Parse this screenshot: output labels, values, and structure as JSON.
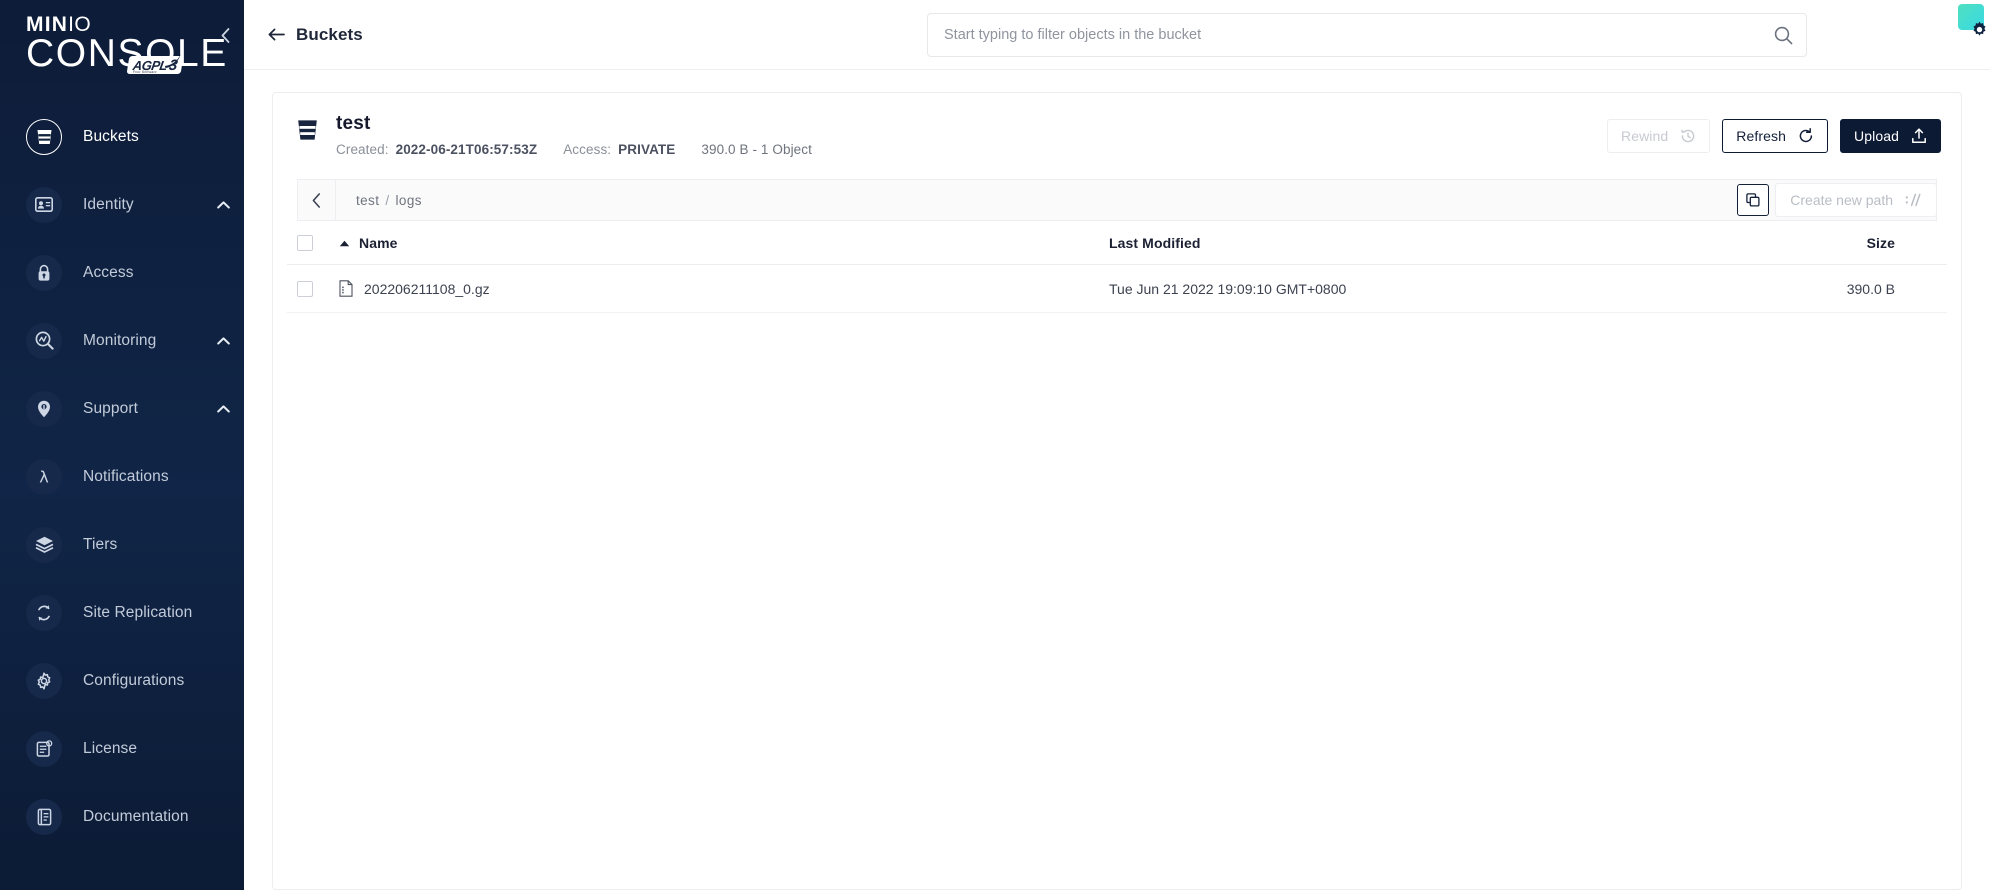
{
  "sidebar": {
    "logo": {
      "brand_primary": "MIN",
      "brand_secondary": "IO",
      "product": "CONSOLE",
      "license_badge": "AGPL",
      "license_version": "3",
      "license_sub": "Free Software"
    },
    "collapse_label": "collapse-sidebar",
    "items": [
      {
        "label": "Buckets",
        "icon": "bucket-icon",
        "active": true,
        "expandable": false
      },
      {
        "label": "Identity",
        "icon": "identity-card-icon",
        "active": false,
        "expandable": true
      },
      {
        "label": "Access",
        "icon": "lock-icon",
        "active": false,
        "expandable": false
      },
      {
        "label": "Monitoring",
        "icon": "monitoring-icon",
        "active": false,
        "expandable": true
      },
      {
        "label": "Support",
        "icon": "support-icon",
        "active": false,
        "expandable": true
      },
      {
        "label": "Notifications",
        "icon": "lambda-icon",
        "active": false,
        "expandable": false
      },
      {
        "label": "Tiers",
        "icon": "layers-icon",
        "active": false,
        "expandable": false
      },
      {
        "label": "Site Replication",
        "icon": "replication-icon",
        "active": false,
        "expandable": false
      },
      {
        "label": "Configurations",
        "icon": "gear-icon",
        "active": false,
        "expandable": false
      },
      {
        "label": "License",
        "icon": "license-doc-icon",
        "active": false,
        "expandable": false
      },
      {
        "label": "Documentation",
        "icon": "book-icon",
        "active": false,
        "expandable": false
      }
    ]
  },
  "topbar": {
    "breadcrumb": "Buckets",
    "back_icon": "arrow-left-icon",
    "search": {
      "value": "",
      "placeholder": "Start typing to filter objects in the bucket",
      "icon": "search-icon"
    },
    "corner_badge_icon": "operator-gear-badge-icon",
    "badge_color": "#4fe0c0"
  },
  "bucket": {
    "icon": "bucket-icon",
    "name": "test",
    "created_label": "Created:",
    "created_value": "2022-06-21T06:57:53Z",
    "access_label": "Access:",
    "access_value": "PRIVATE",
    "size_summary": "390.0 B - 1 Object"
  },
  "actions": {
    "rewind": {
      "label": "Rewind",
      "icon": "rewind-clock-icon",
      "disabled": true
    },
    "refresh": {
      "label": "Refresh",
      "icon": "refresh-icon",
      "disabled": false
    },
    "upload": {
      "label": "Upload",
      "icon": "upload-icon",
      "disabled": false
    }
  },
  "path_bar": {
    "back_icon": "chevron-left-icon",
    "crumbs": [
      "test",
      "logs"
    ],
    "separator": "/",
    "copy_icon": "copy-icon",
    "create_path": {
      "label": "Create new path",
      "icon": "path-slash-icon"
    }
  },
  "table": {
    "columns": [
      {
        "key": "select",
        "label": ""
      },
      {
        "key": "name",
        "label": "Name",
        "sorted": "asc",
        "sort_icon": "caret-up-icon"
      },
      {
        "key": "modified",
        "label": "Last Modified"
      },
      {
        "key": "size",
        "label": "Size"
      }
    ],
    "rows": [
      {
        "selected": false,
        "file_icon": "file-gz-icon",
        "name": "202206211108_0.gz",
        "modified": "Tue Jun 21 2022 19:09:10 GMT+0800",
        "size": "390.0 B"
      }
    ]
  }
}
